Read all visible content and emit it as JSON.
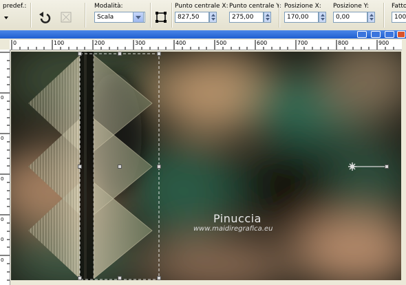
{
  "toolbar": {
    "preset_label": "predef.:",
    "mode_label": "Modalità:",
    "mode_value": "Scala",
    "center_x_label": "Punto centrale X:",
    "center_x_value": "827,50",
    "center_y_label": "Punto centrale Y:",
    "center_y_value": "275,00",
    "pos_x_label": "Posizione X:",
    "pos_x_value": "170,00",
    "pos_y_label": "Posizione Y:",
    "pos_y_value": "0,00",
    "factor_label": "Fatto",
    "factor_value": "100,"
  },
  "ruler": {
    "h_ticks": [
      "0",
      "100",
      "200",
      "300",
      "400",
      "500",
      "600",
      "700",
      "800",
      "900"
    ],
    "v_ticks": [
      "0",
      "0",
      "0",
      "0",
      "0",
      "0"
    ]
  },
  "watermark": {
    "name": "Pinuccia",
    "url": "www.maidiregrafica.eu"
  },
  "colors": {
    "toolbar_bg": "#ece9d8",
    "title_blue": "#2a64d6",
    "canvas_dark": "#1a1a14",
    "canvas_green": "#2f5d48",
    "canvas_tan": "#b8946b"
  }
}
